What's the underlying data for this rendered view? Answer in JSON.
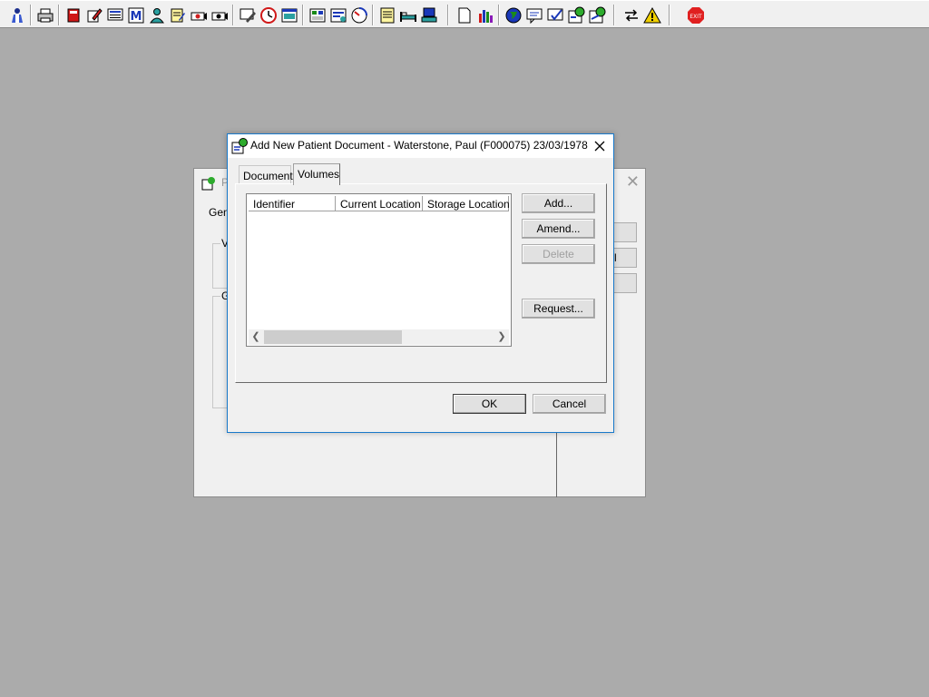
{
  "toolbar": {
    "icons": [
      "patient-icon",
      "printer-icon",
      "book-red-icon",
      "pen-notes-icon",
      "screen-list-icon",
      "letter-m-icon",
      "person-doctor-icon",
      "notepad-edit-icon",
      "camera-icon",
      "camera2-icon",
      "monitor-edit-icon",
      "clock-icon",
      "window-icon",
      "calendar-icon",
      "document-list-icon",
      "gauge-icon",
      "notes-yellow-icon",
      "bed-icon",
      "transfer-icon",
      "blank-document-icon",
      "chart-bars-icon",
      "globe-icon",
      "message-icon",
      "checklist-icon",
      "refresh-green-icon",
      "patient-flag-icon",
      "swap-arrows-icon",
      "warning-icon",
      "exit-icon"
    ],
    "exit_label": "EXIT",
    "colors": {
      "bar": "#f0f0f0",
      "accent_green": "#2dab2d",
      "exit_red": "#e02020"
    }
  },
  "background_window": {
    "title": "P",
    "general_label": "Gen",
    "group1_label": "V",
    "group2_label": "G",
    "side_button_label": "l"
  },
  "dialog": {
    "title": "Add New Patient Document - Waterstone, Paul (F000075) 23/03/1978",
    "tabs": [
      {
        "label": "Document",
        "active": false
      },
      {
        "label": "Volumes",
        "active": true
      }
    ],
    "list": {
      "columns": [
        "Identifier",
        "Current Location",
        "Storage Location"
      ],
      "rows": []
    },
    "buttons": {
      "add": "Add...",
      "amend": "Amend...",
      "delete": "Delete",
      "request": "Request...",
      "ok": "OK",
      "cancel": "Cancel"
    },
    "colors": {
      "border": "#1979ca",
      "face": "#f0f0f0"
    }
  },
  "desktop": {
    "color": "#ababab"
  }
}
